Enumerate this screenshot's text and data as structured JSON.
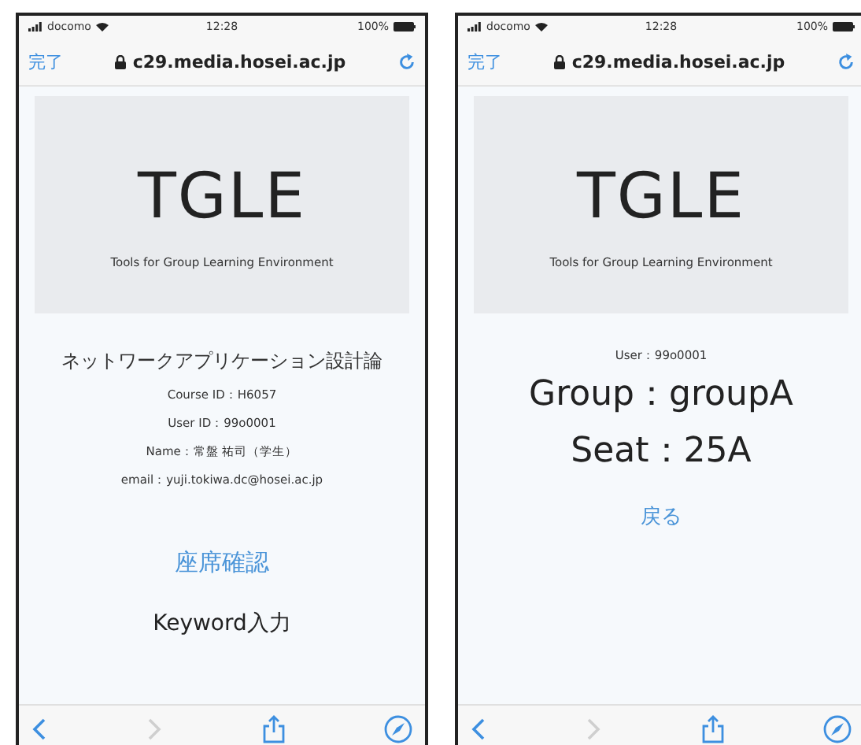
{
  "screens": [
    {
      "status_bar": {
        "carrier": "docomo",
        "time": "12:28",
        "battery": "100%"
      },
      "nav_bar": {
        "done": "完了",
        "url": "c29.media.hosei.ac.jp"
      },
      "banner": {
        "title": "TGLE",
        "subtitle": "Tools for Group Learning Environment"
      },
      "content": [
        {
          "kind": "title",
          "text": "ネットワークアプリケーション設計論"
        },
        {
          "kind": "detail",
          "text": "Course ID：H6057"
        },
        {
          "kind": "detail",
          "text": "User ID：99o0001"
        },
        {
          "kind": "detail",
          "text": "Name：常盤 祐司（学生）"
        },
        {
          "kind": "detail",
          "text": "email：yuji.tokiwa.dc@hosei.ac.jp"
        },
        {
          "kind": "link",
          "text": "座席確認"
        },
        {
          "kind": "action",
          "text": "Keyword入力"
        }
      ],
      "toolbar": {
        "forward_disabled": true
      }
    },
    {
      "status_bar": {
        "carrier": "docomo",
        "time": "12:28",
        "battery": "100%"
      },
      "nav_bar": {
        "done": "完了",
        "url": "c29.media.hosei.ac.jp"
      },
      "banner": {
        "title": "TGLE",
        "subtitle": "Tools for Group Learning Environment"
      },
      "content": [
        {
          "kind": "detail",
          "text": "User：99o0001"
        },
        {
          "kind": "headline",
          "text": "Group：groupA"
        },
        {
          "kind": "headline",
          "text": "Seat：25A"
        },
        {
          "kind": "link",
          "text": "戻る"
        }
      ],
      "toolbar": {
        "forward_disabled": true
      }
    }
  ]
}
